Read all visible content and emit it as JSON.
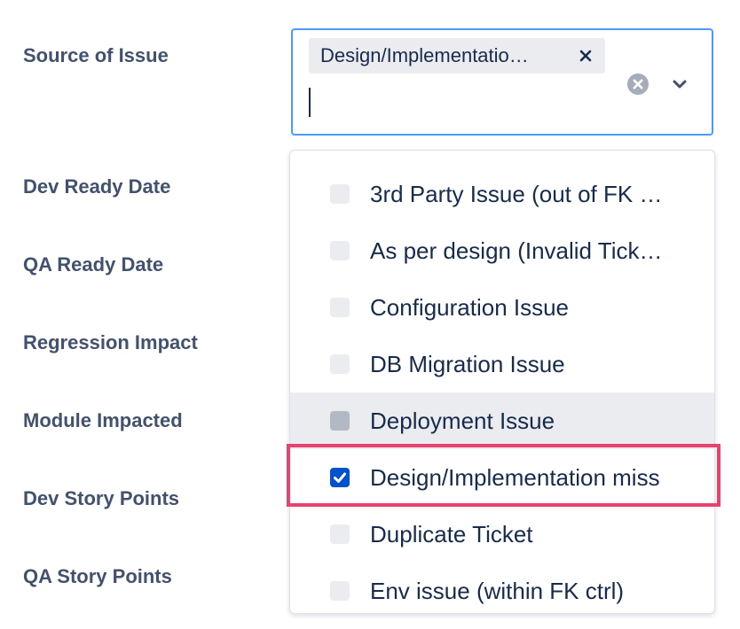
{
  "form": {
    "fields": [
      {
        "label": "Source of Issue"
      },
      {
        "label": "Dev Ready Date"
      },
      {
        "label": "QA Ready Date"
      },
      {
        "label": "Regression Impact"
      },
      {
        "label": "Module Impacted"
      },
      {
        "label": "Dev Story Points"
      },
      {
        "label": "QA Story Points"
      }
    ]
  },
  "select": {
    "selected_chip": "Design/Implementatio…",
    "remove_glyph": "×"
  },
  "menu": {
    "options": [
      {
        "label": "3rd Party Issue (out of FK …",
        "checked": false
      },
      {
        "label": "As per design (Invalid Tick…",
        "checked": false
      },
      {
        "label": "Configuration Issue",
        "checked": false
      },
      {
        "label": "DB Migration Issue",
        "checked": false
      },
      {
        "label": "Deployment Issue",
        "checked": false,
        "hover": true
      },
      {
        "label": "Design/Implementation miss",
        "checked": true
      },
      {
        "label": "Duplicate Ticket",
        "checked": false
      },
      {
        "label": "Env issue (within FK ctrl)",
        "checked": false
      }
    ]
  },
  "colors": {
    "focus_border": "#4c9aff",
    "checkbox_checked": "#0052cc",
    "highlight": "#e8436c",
    "label_text": "#42526e"
  }
}
